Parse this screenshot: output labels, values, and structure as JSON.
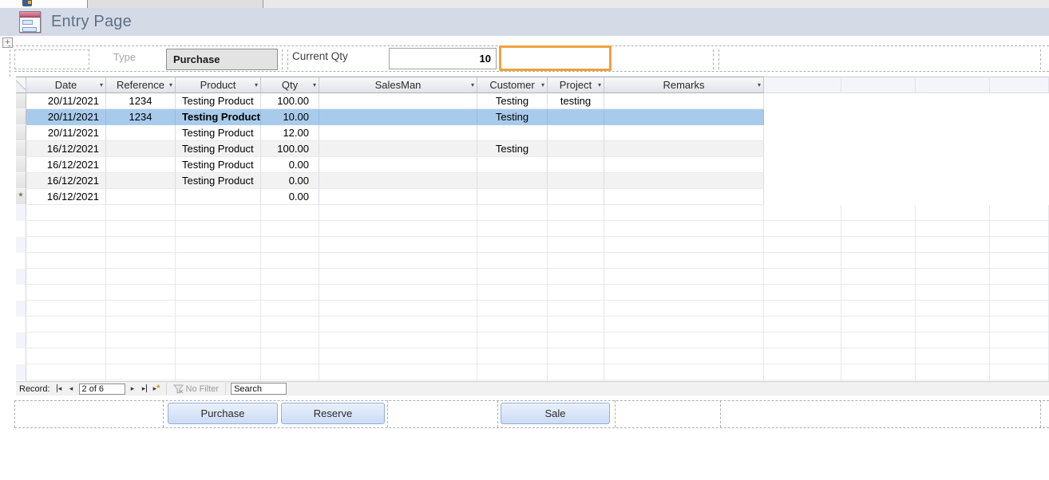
{
  "tab_strip": {
    "active_tab_note": "Entry Page tab (clipped)"
  },
  "title_bar": {
    "title": "Entry Page"
  },
  "form_header": {
    "type_label": "Type",
    "type_value": "Purchase",
    "qty_label": "Current Qty",
    "qty_value": "10"
  },
  "datasheet": {
    "columns": [
      {
        "label": "Date"
      },
      {
        "label": "Reference"
      },
      {
        "label": "Product"
      },
      {
        "label": "Qty"
      },
      {
        "label": "SalesMan"
      },
      {
        "label": "Customer"
      },
      {
        "label": "Project"
      },
      {
        "label": "Remarks"
      }
    ],
    "dropdown_arrow": "▾",
    "rows": [
      {
        "cells": [
          "20/11/2021",
          "1234",
          "Testing Product",
          "100.00",
          "",
          "Testing",
          "testing",
          ""
        ]
      },
      {
        "cells": [
          "20/11/2021",
          "1234",
          "Testing Product",
          "10.00",
          "",
          "Testing",
          "",
          ""
        ],
        "selected": true,
        "bold_col": 2
      },
      {
        "cells": [
          "20/11/2021",
          "",
          "Testing Product",
          "12.00",
          "",
          "",
          "",
          ""
        ]
      },
      {
        "cells": [
          "16/12/2021",
          "",
          "Testing Product",
          "100.00",
          "",
          "Testing",
          "",
          ""
        ],
        "alt": true
      },
      {
        "cells": [
          "16/12/2021",
          "",
          "Testing Product",
          "0.00",
          "",
          "",
          "",
          ""
        ]
      },
      {
        "cells": [
          "16/12/2021",
          "",
          "Testing Product",
          "0.00",
          "",
          "",
          "",
          ""
        ],
        "alt": true
      },
      {
        "cells": [
          "16/12/2021",
          "",
          "",
          "0.00",
          "",
          "",
          "",
          ""
        ],
        "new_record": true
      }
    ],
    "new_record_marker": "*",
    "colors": {
      "selected_row": "#A8CBEB",
      "alt_row": "#F2F2F2"
    }
  },
  "record_nav": {
    "label": "Record:",
    "position": "2 of 6",
    "first_glyph": "◂",
    "prev_glyph": "◂",
    "next_glyph": "▸",
    "last_glyph": "▸",
    "new_glyph": "▸",
    "new_star": "*",
    "no_filter_label": "No Filter",
    "search_placeholder": "Search"
  },
  "action_buttons": [
    {
      "label": "Purchase"
    },
    {
      "label": "Reserve"
    },
    {
      "label": "Sale"
    }
  ],
  "colors": {
    "focus_orange": "#F0A23D",
    "title_bar_bg": "#D4DBE7",
    "button_border": "#94AFDC"
  }
}
